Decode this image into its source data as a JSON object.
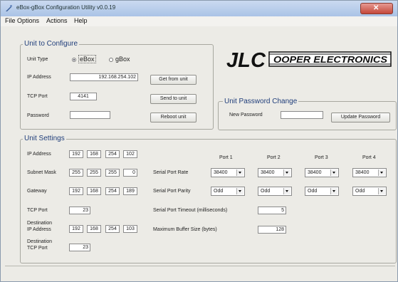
{
  "window": {
    "title": "eBox-gBox Configuration Utility v0.0.19"
  },
  "menu": [
    "File",
    "Options",
    "Actions",
    "Help"
  ],
  "unit_to_configure": {
    "title": "Unit to Configure",
    "unit_type_label": "Unit Type",
    "options": [
      "eBox",
      "gBox"
    ],
    "selected": "eBox",
    "ip_label": "IP Address",
    "ip_value": "192.168.254.102",
    "tcp_label": "TCP Port",
    "tcp_value": "4141",
    "password_label": "Password",
    "password_value": "",
    "buttons": {
      "get": "Get from unit",
      "send": "Send to unit",
      "reboot": "Reboot unit"
    }
  },
  "logo": {
    "text": "JLCOOPER ELECTRONICS"
  },
  "password_change": {
    "title": "Unit Password Change",
    "new_label": "New Password",
    "new_value": "",
    "update_button": "Update Password"
  },
  "unit_settings": {
    "title": "Unit Settings",
    "ip_label": "IP Address",
    "ip": [
      "192",
      "168",
      "254",
      "102"
    ],
    "subnet_label": "Subnet Mask",
    "subnet": [
      "255",
      "255",
      "255",
      "0"
    ],
    "gateway_label": "Gateway",
    "gateway": [
      "192",
      "168",
      "254",
      "189"
    ],
    "tcp_label": "TCP Port",
    "tcp_value": "23",
    "dest_ip_label_1": "Destination",
    "dest_ip_label_2": "IP Address",
    "dest_ip": [
      "192",
      "168",
      "254",
      "103"
    ],
    "dest_tcp_label_1": "Destination",
    "dest_tcp_label_2": "TCP Port",
    "dest_tcp_value": "23",
    "ports": [
      "Port 1",
      "Port 2",
      "Port 3",
      "Port 4"
    ],
    "rate_label": "Serial Port Rate",
    "rates": [
      "38400",
      "38400",
      "38400",
      "38400"
    ],
    "parity_label": "Serial Port Parity",
    "parities": [
      "Odd",
      "Odd",
      "Odd",
      "Odd"
    ],
    "timeout_label": "Serial Port Timeout (milliseconds)",
    "timeout_value": "5",
    "buffer_label": "Maximum Buffer Size (bytes)",
    "buffer_value": "128"
  },
  "colors": {
    "group_title": "#1f3d7a",
    "titlebar": "#aac3e6",
    "close": "#c4473a"
  }
}
